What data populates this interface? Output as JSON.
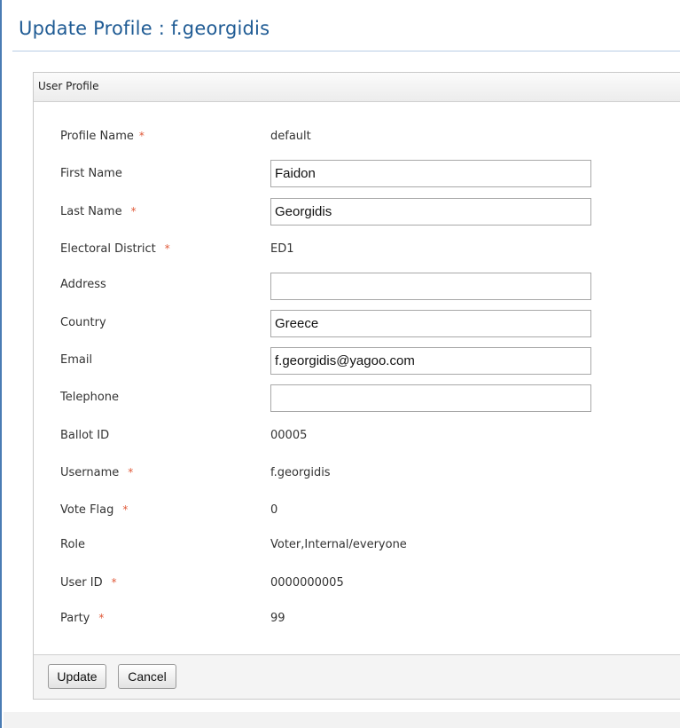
{
  "page": {
    "title": "Update Profile : f.georgidis"
  },
  "panel": {
    "header": "User Profile"
  },
  "required_marker": "*",
  "fields": {
    "profile_name": {
      "label": "Profile Name",
      "value": "default"
    },
    "first_name": {
      "label": "First Name",
      "value": "Faidon"
    },
    "last_name": {
      "label": "Last Name",
      "value": "Georgidis"
    },
    "electoral_district": {
      "label": "Electoral District",
      "value": "ED1"
    },
    "address": {
      "label": "Address",
      "value": ""
    },
    "country": {
      "label": "Country",
      "value": "Greece"
    },
    "email": {
      "label": "Email",
      "value": "f.georgidis@yagoo.com"
    },
    "telephone": {
      "label": "Telephone",
      "value": ""
    },
    "ballot_id": {
      "label": "Ballot ID",
      "value": "00005"
    },
    "username": {
      "label": "Username",
      "value": "f.georgidis"
    },
    "vote_flag": {
      "label": "Vote Flag",
      "value": "0"
    },
    "role": {
      "label": "Role",
      "value": "Voter,Internal/everyone"
    },
    "user_id": {
      "label": "User ID",
      "value": "0000000005"
    },
    "party": {
      "label": "Party",
      "value": "99"
    }
  },
  "buttons": {
    "update": "Update",
    "cancel": "Cancel"
  },
  "colors": {
    "title": "#1f5b94",
    "required": "#e05a3a",
    "frame": "#4a7cb4"
  }
}
